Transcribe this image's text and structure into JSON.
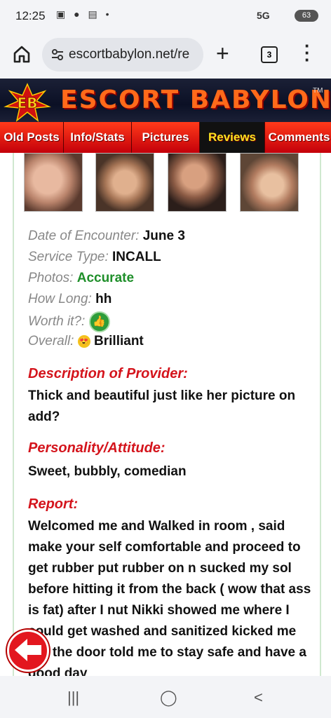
{
  "status_bar": {
    "time": "12:25",
    "network": "5G",
    "battery": "63"
  },
  "browser": {
    "url": "escortbabylon.net/re",
    "tab_count": "3"
  },
  "site": {
    "logo_text": "EB",
    "title": "ESCORT BABYLON",
    "tm": "TM",
    "nav": [
      {
        "label": "Old Posts"
      },
      {
        "label": "Info/Stats"
      },
      {
        "label": "Pictures"
      },
      {
        "label": "Reviews",
        "active": true
      },
      {
        "label": "Comments"
      }
    ]
  },
  "review": {
    "date_label": "Date of Encounter:",
    "date_value": "June 3",
    "service_label": "Service Type:",
    "service_value": "INCALL",
    "photos_label": "Photos:",
    "photos_value": "Accurate",
    "howlong_label": "How Long:",
    "howlong_value": "hh",
    "worth_label": "Worth it?:",
    "overall_label": "Overall:",
    "overall_value": "Brilliant",
    "desc_heading": "Description of Provider:",
    "desc_text": "Thick and beautiful just like her picture on add?",
    "personality_heading": "Personality/Attitude:",
    "personality_text": "Sweet, bubbly, comedian",
    "report_heading": "Report:",
    "report_text": "Welcomed me and Walked in room , said make your self comfortable and proceed to get rubber put rubber on n sucked my sol before hitting it from the back ( wow that ass is fat) after I nut Nikki showed me where I could get washed and sanitized kicked me out the door told me to stay safe and have a good day"
  },
  "colors": {
    "nav_active_text": "#ffe320",
    "heading_red": "#d4141c",
    "accurate_green": "#1f8f2a"
  }
}
